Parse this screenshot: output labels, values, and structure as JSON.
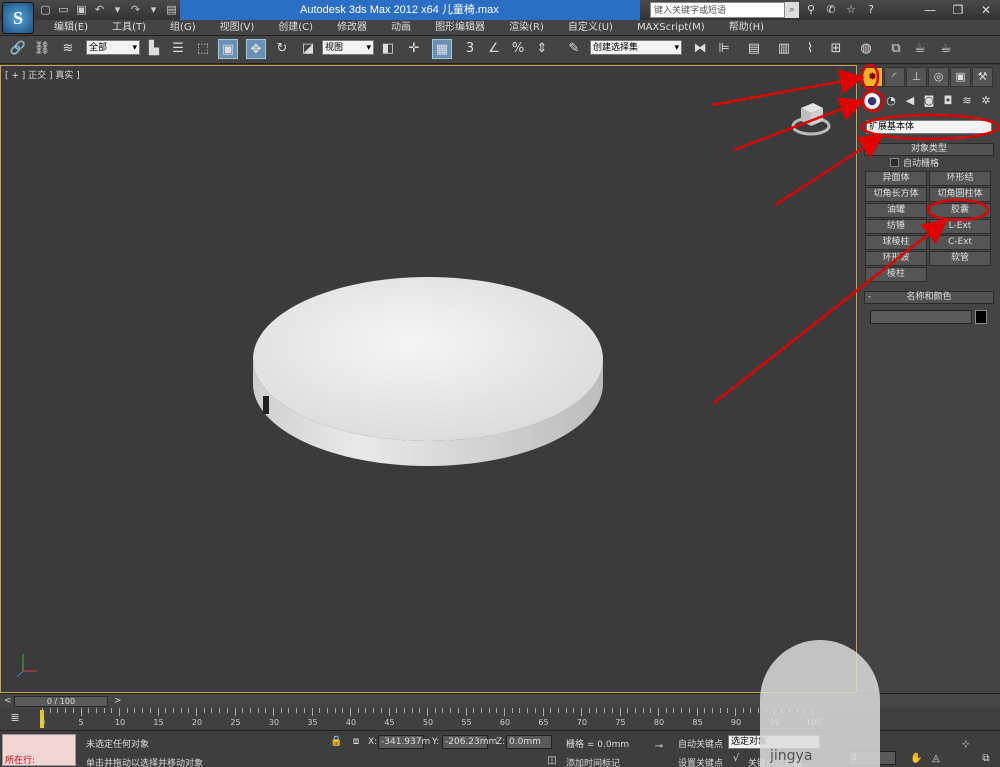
{
  "titlebar": {
    "app_logo": "S",
    "title": "Autodesk 3ds Max  2012 x64      儿童椅.max",
    "search_placeholder": "键入关键字或短语"
  },
  "menu": [
    "编辑(E)",
    "工具(T)",
    "组(G)",
    "视图(V)",
    "创建(C)",
    "修改器",
    "动画",
    "图形编辑器",
    "渲染(R)",
    "自定义(U)",
    "MAXScript(M)",
    "帮助(H)"
  ],
  "toolbar": {
    "selection_filter": "全部",
    "reference_coord": "视图",
    "snap_label": "3",
    "percent_label": "%",
    "named_selection": "创建选择集"
  },
  "viewport": {
    "label": "[ + ] 正交 ] 真实 ]"
  },
  "command_panel": {
    "category_dropdown": "扩展基本体",
    "object_type_title": "对象类型",
    "autogrid_label": "自动栅格",
    "object_buttons": [
      "异面体",
      "环形结",
      "切角长方体",
      "切角圆柱体",
      "油罐",
      "胶囊",
      "纺锤",
      "L-Ext",
      "球棱柱",
      "C-Ext",
      "环形波",
      "软管",
      "棱柱"
    ],
    "name_color_title": "名称和颜色"
  },
  "timeline": {
    "frame_counter": "0 / 100",
    "prev_arrow": "<",
    "next_arrow": ">",
    "ruler_labels": [
      "0",
      "5",
      "10",
      "15",
      "20",
      "25",
      "30",
      "35",
      "40",
      "45",
      "50",
      "55",
      "60",
      "65",
      "70",
      "75",
      "80",
      "85",
      "90",
      "95",
      "100"
    ]
  },
  "statusbar": {
    "maxscript_line2": "所在行:",
    "status_line1": "未选定任何对象",
    "status_line2": "单击并拖动以选择并移动对象",
    "x_label": "X:",
    "x_value": "-341.937m",
    "y_label": "Y:",
    "y_value": "-206.23mm",
    "z_label": "Z:",
    "z_value": "0.0mm",
    "grid_text": "栅格 = 0.0mm",
    "add_time_tag": "添加时间标记",
    "auto_key": "自动关键点",
    "set_key": "设置关键点",
    "key_mode": "选定对象",
    "key_filter": "关键点过滤器...",
    "frame_field": "0",
    "watermark": "jingya"
  }
}
